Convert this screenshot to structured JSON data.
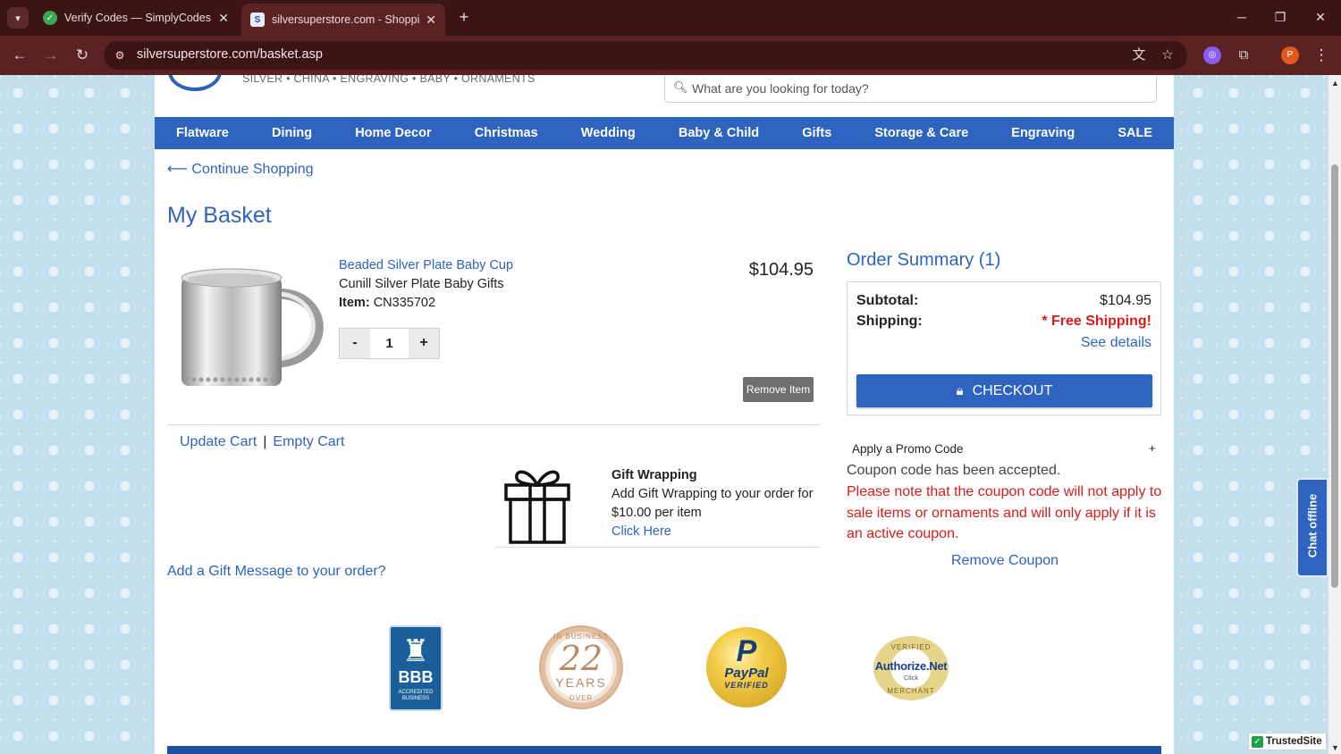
{
  "browser": {
    "tabs": [
      {
        "title": "Verify Codes — SimplyCodes",
        "icon": "simplycodes-favicon"
      },
      {
        "title": "silversuperstore.com - Shopping",
        "icon": "silversuperstore-favicon"
      }
    ],
    "url": "silversuperstore.com/basket.asp",
    "profile_initial": "P"
  },
  "header": {
    "tagline": "SILVER • CHINA • ENGRAVING • BABY • ORNAMENTS",
    "search_placeholder": "What are you looking for today?"
  },
  "nav": [
    "Flatware",
    "Dining",
    "Home Decor",
    "Christmas",
    "Wedding",
    "Baby & Child",
    "Gifts",
    "Storage & Care",
    "Engraving",
    "SALE"
  ],
  "continue_shopping": "Continue Shopping",
  "page_title": "My Basket",
  "cart_item": {
    "name": "Beaded Silver Plate Baby Cup",
    "brand": "Cunill Silver Plate Baby Gifts",
    "item_label": "Item:",
    "item_number": "CN335702",
    "price": "$104.95",
    "quantity": "1",
    "minus": "-",
    "plus": "+",
    "remove_label": "Remove Item"
  },
  "cart_actions": {
    "update": "Update Cart",
    "separator": "|",
    "empty": "Empty Cart"
  },
  "gift_wrap": {
    "title": "Gift Wrapping",
    "line1": "Add Gift Wrapping to your order for",
    "line2": "$10.00 per item",
    "link": "Click Here"
  },
  "gift_message": "Add a Gift Message to your order?",
  "summary": {
    "title": "Order Summary (1)",
    "subtotal_label": "Subtotal:",
    "subtotal_value": "$104.95",
    "shipping_label": "Shipping:",
    "shipping_value": "* Free Shipping!",
    "see_details": "See details",
    "checkout": "CHECKOUT"
  },
  "promo": {
    "label": "Apply a Promo Code",
    "toggle": "+",
    "accepted": "Coupon code has been accepted.",
    "note": "Please note that the coupon code will not apply to sale items or ornaments and will only apply if it is an active coupon.",
    "remove": "Remove Coupon"
  },
  "badges": {
    "bbb": {
      "mark": "BBB",
      "caption": "ACCREDITED BUSINESS"
    },
    "years": {
      "top": "IN BUSINESS",
      "number": "22",
      "word": "YEARS",
      "bottom": "OVER"
    },
    "paypal": {
      "brand": "PayPal",
      "caption": "VERIFIED"
    },
    "authorize": {
      "top": "VERIFIED",
      "brand": "Authorize.Net",
      "click": "Click",
      "bottom": "MERCHANT"
    }
  },
  "chat": "Chat offline",
  "trusted_site": "TrustedSite",
  "colors": {
    "brand_blue": "#2e63bf",
    "alert_red": "#d81b1b",
    "chrome": "#3b1414"
  }
}
